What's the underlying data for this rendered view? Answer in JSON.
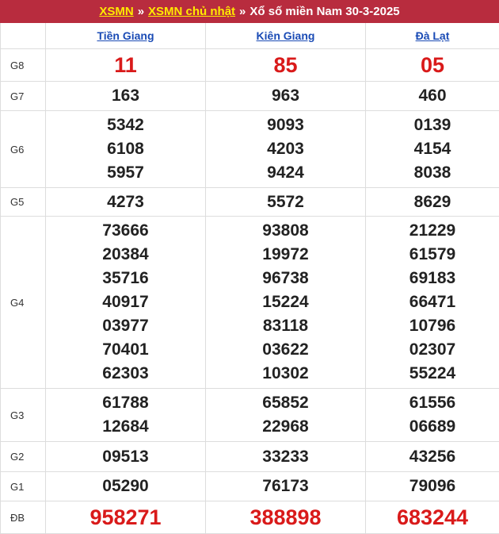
{
  "header": {
    "link1": "XSMN",
    "sep1": "»",
    "link2": "XSMN chủ nhật",
    "sep2": "»",
    "title": "Xổ số miền Nam 30-3-2025"
  },
  "provinces": [
    "Tiền Giang",
    "Kiên Giang",
    "Đà Lạt"
  ],
  "prizes": [
    {
      "key": "g8",
      "label": "G8",
      "values": [
        [
          "11"
        ],
        [
          "85"
        ],
        [
          "05"
        ]
      ]
    },
    {
      "key": "g7",
      "label": "G7",
      "values": [
        [
          "163"
        ],
        [
          "963"
        ],
        [
          "460"
        ]
      ]
    },
    {
      "key": "g6",
      "label": "G6",
      "values": [
        [
          "5342",
          "6108",
          "5957"
        ],
        [
          "9093",
          "4203",
          "9424"
        ],
        [
          "0139",
          "4154",
          "8038"
        ]
      ]
    },
    {
      "key": "g5",
      "label": "G5",
      "values": [
        [
          "4273"
        ],
        [
          "5572"
        ],
        [
          "8629"
        ]
      ]
    },
    {
      "key": "g4",
      "label": "G4",
      "values": [
        [
          "73666",
          "20384",
          "35716",
          "40917",
          "03977",
          "70401",
          "62303"
        ],
        [
          "93808",
          "19972",
          "96738",
          "15224",
          "83118",
          "03622",
          "10302"
        ],
        [
          "21229",
          "61579",
          "69183",
          "66471",
          "10796",
          "02307",
          "55224"
        ]
      ]
    },
    {
      "key": "g3",
      "label": "G3",
      "values": [
        [
          "61788",
          "12684"
        ],
        [
          "65852",
          "22968"
        ],
        [
          "61556",
          "06689"
        ]
      ]
    },
    {
      "key": "g2",
      "label": "G2",
      "values": [
        [
          "09513"
        ],
        [
          "33233"
        ],
        [
          "43256"
        ]
      ]
    },
    {
      "key": "g1",
      "label": "G1",
      "values": [
        [
          "05290"
        ],
        [
          "76173"
        ],
        [
          "79096"
        ]
      ]
    },
    {
      "key": "db",
      "label": "ĐB",
      "values": [
        [
          "958271"
        ],
        [
          "388898"
        ],
        [
          "683244"
        ]
      ]
    }
  ],
  "colors": {
    "header_bg": "#b82c3e",
    "header_link": "#ffea00",
    "highlight_red": "#d91a1a",
    "province_link": "#1a4bb5"
  }
}
